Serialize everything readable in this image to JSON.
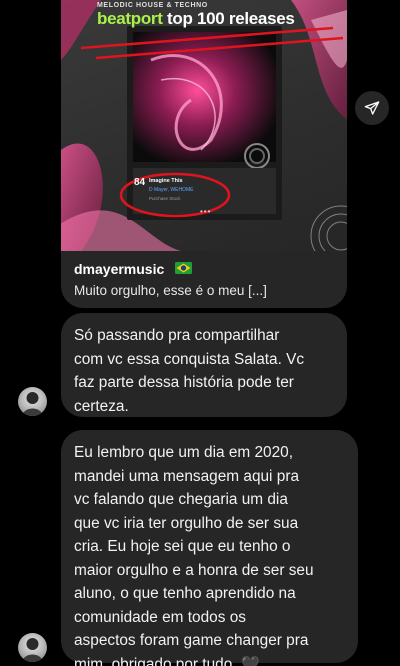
{
  "post": {
    "genre_label": "MELODIC HOUSE & TECHNO",
    "headline_brand": "beatport",
    "headline_rest": " top 100 releases",
    "track_rank": "84",
    "track_title": "Imagine This",
    "track_artists": "D Mayer, WEHOME",
    "track_label": "Purchase Stock",
    "more_dots": "•••",
    "username": "dmayermusic",
    "flag": "brazil-flag",
    "caption": "Muito orgulho, esse é o meu [...]"
  },
  "messages": [
    {
      "text": "Só passando pra compartilhar\ncom vc essa conquista Salata. Vc\nfaz parte dessa história pode ter\ncerteza."
    },
    {
      "text": "Eu lembro que um dia em 2020,\nmandei uma mensagem aqui pra\nvc falando que chegaria um dia\nque vc iria ter orgulho de ser sua\ncria. Eu hoje sei que eu tenho o\nmaior orgulho e a honra de ser seu\naluno, o que tenho aprendido na\ncomunidade em todos os\naspectos foram game changer pra\nmim, obrigado por tudo. 🖤"
    }
  ],
  "colors": {
    "background": "#000000",
    "bubble": "#262626",
    "brand_green": "#a9f24a",
    "annotation_red": "#e0141e",
    "accent_pink": "#e0307a"
  },
  "icons": {
    "share": "paper-plane-icon",
    "avatar": "user-photo"
  }
}
